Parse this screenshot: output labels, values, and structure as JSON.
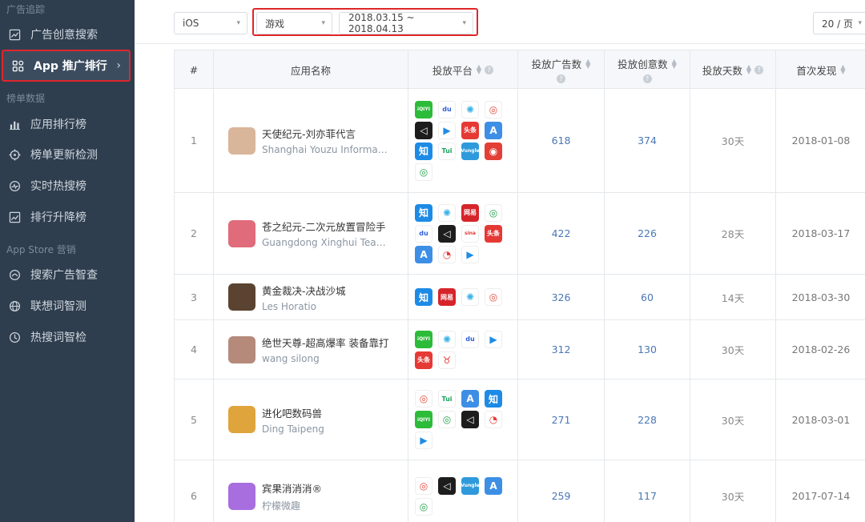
{
  "sidebar": {
    "sections": [
      {
        "label": "广告追踪",
        "items": [
          {
            "label": "广告创意搜索",
            "icon": "chart-icon"
          },
          {
            "label": "App 推广排行",
            "icon": "grid-icon",
            "active": true
          }
        ]
      },
      {
        "label": "榜单数据",
        "items": [
          {
            "label": "应用排行榜",
            "icon": "bar-chart-icon"
          },
          {
            "label": "榜单更新检测",
            "icon": "target-icon"
          },
          {
            "label": "实时热搜榜",
            "icon": "pulse-icon"
          },
          {
            "label": "排行升降榜",
            "icon": "trend-icon"
          }
        ]
      },
      {
        "label": "App Store 营销",
        "items": [
          {
            "label": "搜索广告智查",
            "icon": "search-ad-icon"
          },
          {
            "label": "联想词智测",
            "icon": "globe-icon"
          },
          {
            "label": "热搜词智检",
            "icon": "clock-icon"
          }
        ]
      }
    ],
    "active_chevron": "›"
  },
  "filters": {
    "platform": "iOS",
    "category": "游戏",
    "date_range": "2018.03.15 ~ 2018.04.13",
    "page_size": "20 / 页"
  },
  "table": {
    "headers": {
      "index": "#",
      "app": "应用名称",
      "platform": "投放平台",
      "ads": "投放广告数",
      "creatives": "投放创意数",
      "days": "投放天数",
      "first_seen": "首次发现"
    },
    "rows": [
      {
        "index": "1",
        "name": "天使纪元-刘亦菲代言",
        "dev": "Shanghai Youzu Information...",
        "ads": "618",
        "creatives": "374",
        "days": "30天",
        "first_seen": "2018-01-08",
        "platforms": [
          "iqiyi",
          "baidu",
          "pinwheel",
          "tencent",
          "unity",
          "youku",
          "toutiao",
          "appstore",
          "zhihu",
          "tui",
          "vungle",
          "sohu",
          "tencent2"
        ]
      },
      {
        "index": "2",
        "name": "苍之纪元-二次元放置冒险手",
        "dev": "Guangdong Xinghui Teamtop...",
        "ads": "422",
        "creatives": "226",
        "days": "28天",
        "first_seen": "2018-03-17",
        "platforms": [
          "zhihu",
          "pinwheel",
          "netease",
          "tencent2",
          "baidu",
          "unity",
          "sina",
          "toutiao",
          "appstore",
          "weibo",
          "youku"
        ]
      },
      {
        "index": "3",
        "name": "黄金裁决-决战沙城",
        "dev": "Les Horatio",
        "ads": "326",
        "creatives": "60",
        "days": "14天",
        "first_seen": "2018-03-30",
        "platforms": [
          "zhihu",
          "netease",
          "pinwheel",
          "tencent"
        ]
      },
      {
        "index": "4",
        "name": "绝世天尊-超高爆率 装备靠打",
        "dev": "wang silong",
        "ads": "312",
        "creatives": "130",
        "days": "30天",
        "first_seen": "2018-02-26",
        "platforms": [
          "iqiyi",
          "pinwheel",
          "baidu",
          "youku",
          "toutiao",
          "bull"
        ]
      },
      {
        "index": "5",
        "name": "进化吧数码兽",
        "dev": "Ding Taipeng",
        "ads": "271",
        "creatives": "228",
        "days": "30天",
        "first_seen": "2018-03-01",
        "platforms": [
          "tencent",
          "tui",
          "appstore",
          "zhihu",
          "iqiyi",
          "tencent2",
          "unity",
          "weibo",
          "youku"
        ]
      },
      {
        "index": "6",
        "name": "宾果消消消®",
        "dev": "柠檬微趣",
        "ads": "259",
        "creatives": "117",
        "days": "30天",
        "first_seen": "2017-07-14",
        "platforms": [
          "tencent",
          "unity",
          "vungle",
          "appstore",
          "tencent2"
        ]
      }
    ]
  },
  "platform_icons": {
    "iqiyi": {
      "label": "iQIYI",
      "bg": "#2dbb3a",
      "fg": "#ffffff"
    },
    "baidu": {
      "label": "du",
      "bg": "#ffffff",
      "fg": "#2f5fd6"
    },
    "pinwheel": {
      "label": "✺",
      "bg": "#ffffff",
      "fg": "#3bb3e8"
    },
    "tencent": {
      "label": "◎",
      "bg": "#ffffff",
      "fg": "#e24b3c"
    },
    "tencent2": {
      "label": "◎",
      "bg": "#ffffff",
      "fg": "#22a04b"
    },
    "unity": {
      "label": "◁",
      "bg": "#1d1d1d",
      "fg": "#ffffff"
    },
    "youku": {
      "label": "▶",
      "bg": "#ffffff",
      "fg": "#1f8ce6"
    },
    "toutiao": {
      "label": "头条",
      "bg": "#e53935",
      "fg": "#ffffff"
    },
    "appstore": {
      "label": "A",
      "bg": "#3d8fe6",
      "fg": "#ffffff"
    },
    "zhihu": {
      "label": "知",
      "bg": "#1d8be6",
      "fg": "#ffffff"
    },
    "tui": {
      "label": "Tui",
      "bg": "#ffffff",
      "fg": "#1aa05b"
    },
    "vungle": {
      "label": "Vungle",
      "bg": "#2e9adb",
      "fg": "#ffffff"
    },
    "sohu": {
      "label": "◉",
      "bg": "#e23f36",
      "fg": "#ffffff"
    },
    "netease": {
      "label": "网易",
      "bg": "#d5252b",
      "fg": "#ffffff"
    },
    "sina": {
      "label": "sina",
      "bg": "#ffffff",
      "fg": "#e53935"
    },
    "weibo": {
      "label": "◔",
      "bg": "#ffffff",
      "fg": "#e53935"
    },
    "bull": {
      "label": "♉",
      "bg": "#ffffff",
      "fg": "#e53935"
    }
  },
  "app_icon_colors": [
    "#d9b59a",
    "#e06b7a",
    "#5a4330",
    "#b58a7a",
    "#e0a43c",
    "#a86ee0"
  ]
}
